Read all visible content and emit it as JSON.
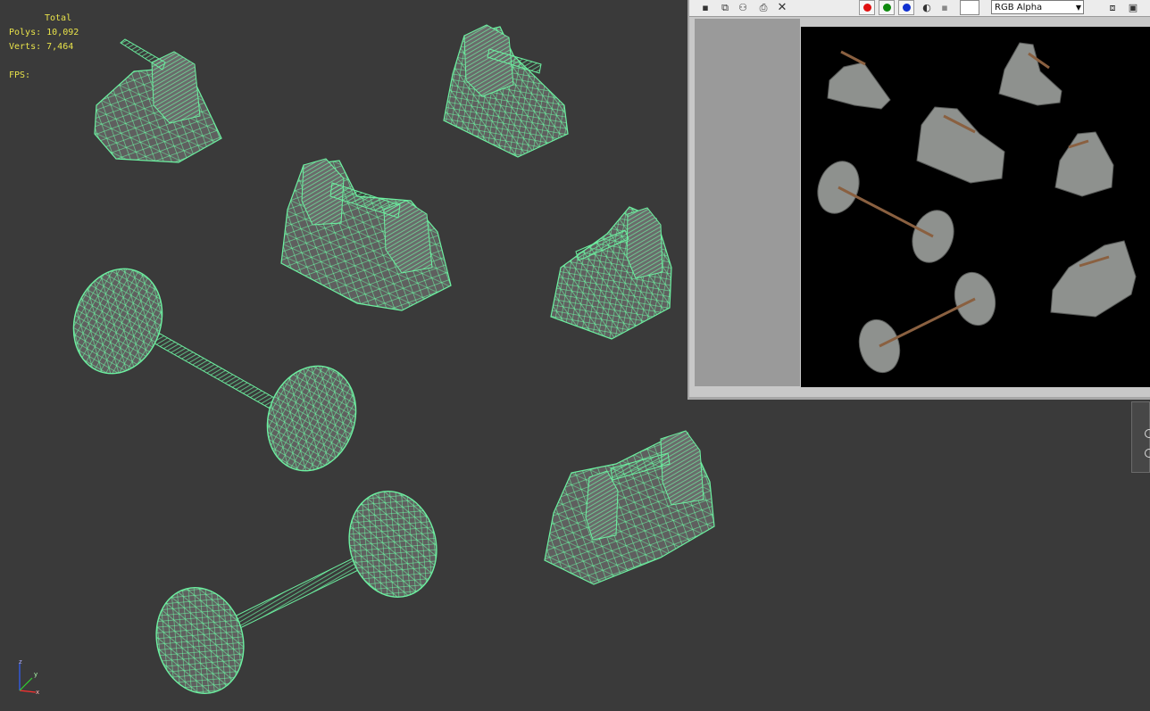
{
  "viewport": {
    "stats": {
      "title": "Total",
      "polys": "Polys: 10,092",
      "verts": "Verts: 7,464",
      "fps": "FPS:"
    },
    "wire_color": "#6cf0a0",
    "shade_color": "#6a6a6a",
    "axis_labels": {
      "x": "x",
      "y": "y",
      "z": "z"
    }
  },
  "render_window": {
    "toolbar": {
      "icons": [
        "save-icon",
        "copy-icon",
        "clone-icon",
        "print-icon",
        "clear-icon"
      ],
      "channels": [
        {
          "name": "red-channel",
          "color": "#e01010"
        },
        {
          "name": "green-channel",
          "color": "#108a10"
        },
        {
          "name": "blue-channel",
          "color": "#1030d0"
        }
      ],
      "channel_select": "RGB Alpha"
    }
  },
  "colors": {
    "viewport_bg": "#3a3a3a",
    "stats_text": "#e8e24a",
    "panel_grey": "#9a9a9a"
  }
}
